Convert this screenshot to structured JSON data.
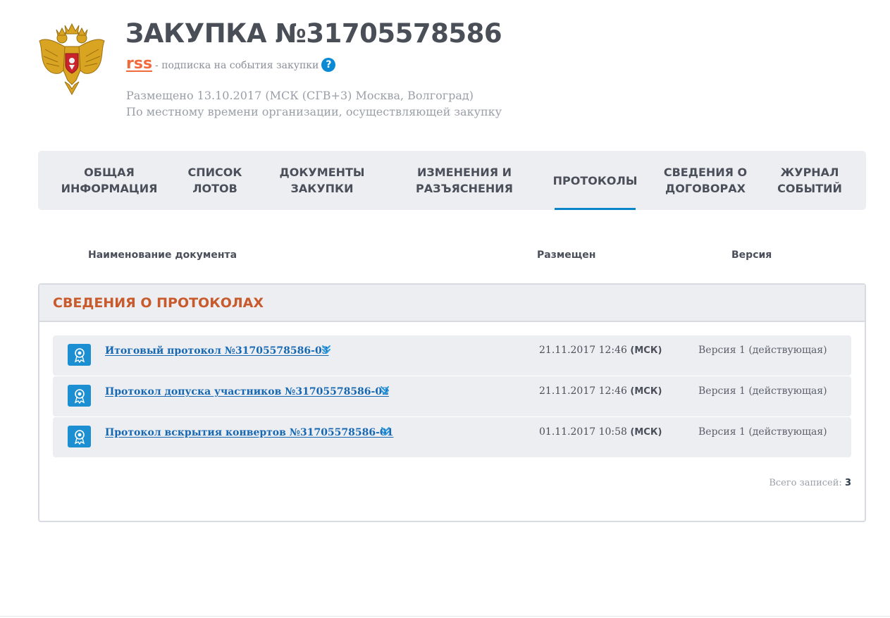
{
  "header": {
    "title": "ЗАКУПКА №31705578586",
    "rss_label": "rss",
    "rss_text": "- подписка на события закупки",
    "help_symbol": "?",
    "posted_line1": "Размещено 13.10.2017 (МСК (СГВ+3) Москва, Волгоград)",
    "posted_line2": "По местному времени организации, осуществляющей закупку"
  },
  "tabs": [
    {
      "line1": "ОБЩАЯ",
      "line2": "ИНФОРМАЦИЯ"
    },
    {
      "line1": "СПИСОК",
      "line2": "ЛОТОВ"
    },
    {
      "line1": "ДОКУМЕНТЫ",
      "line2": "ЗАКУПКИ"
    },
    {
      "line1": "ИЗМЕНЕНИЯ И",
      "line2": "РАЗЪЯСНЕНИЯ"
    },
    {
      "line1": "ПРОТОКОЛЫ",
      "line2": ""
    },
    {
      "line1": "СВЕДЕНИЯ О",
      "line2": "ДОГОВОРАХ"
    },
    {
      "line1": "ЖУРНАЛ",
      "line2": "СОБЫТИЙ"
    }
  ],
  "active_tab": "ПРОТОКОЛЫ",
  "columns": {
    "name": "Наименование документа",
    "posted": "Размещен",
    "version": "Версия"
  },
  "panel": {
    "title": "СВЕДЕНИЯ О ПРОТОКОЛАХ",
    "rows": [
      {
        "name": "Итоговый протокол №31705578586-03",
        "date": "21.11.2017 12:46",
        "tz": "(МСК)",
        "version": "Версия 1 (действующая)"
      },
      {
        "name": "Протокол допуска участников №31705578586-02",
        "date": "21.11.2017 12:46",
        "tz": "(МСК)",
        "version": "Версия 1 (действующая)"
      },
      {
        "name": "Протокол вскрытия конвертов №31705578586-01",
        "date": "01.11.2017 10:58",
        "tz": "(МСК)",
        "version": "Версия 1 (действующая)"
      }
    ],
    "total_label": "Всего записей:",
    "total_value": "3"
  },
  "colors": {
    "accent": "#0a85c9",
    "rss": "#f06a3c",
    "panel_title": "#c85a2c",
    "link": "#1668b3"
  }
}
